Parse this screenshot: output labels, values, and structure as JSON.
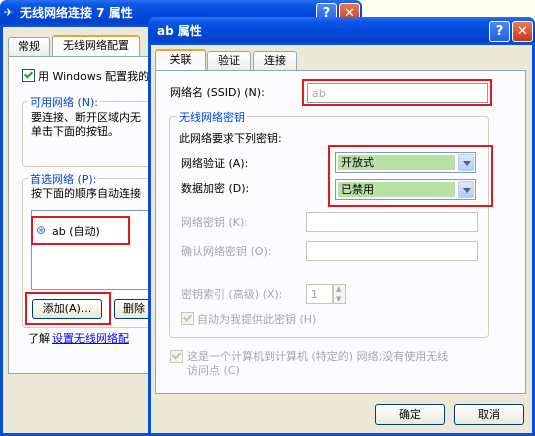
{
  "bg_window": {
    "title": "无线网络连接 7 属性",
    "tabs": [
      "常规",
      "无线网络配置"
    ],
    "use_windows_config": "用 Windows 配置我的",
    "available_networks": {
      "group_label": "可用网络 (N):",
      "desc_line1": "要连接、断开区域内无",
      "desc_line2": "单击下面的按钮。"
    },
    "preferred_networks": {
      "group_label": "首选网络 (P):",
      "desc": "按下面的顺序自动连接",
      "items": [
        "ab (自动)"
      ]
    },
    "add_button": "添加(A)...",
    "remove_button": "删除",
    "learn_prefix": "了解",
    "learn_link": "设置无线网络配"
  },
  "dialog": {
    "title": "ab 属性",
    "tabs": [
      "关联",
      "验证",
      "连接"
    ],
    "ssid": {
      "label": "网络名 (SSID) (N):",
      "value": "ab"
    },
    "security_group": {
      "label": "无线网络密钥",
      "required_text": "此网络要求下列密钥:",
      "auth": {
        "label": "网络验证 (A):",
        "value": "开放式"
      },
      "encryption": {
        "label": "数据加密 (D):",
        "value": "已禁用"
      },
      "network_key_label": "网络密钥 (K):",
      "confirm_key_label": "确认网络密钥 (O):",
      "key_index_label": "密钥索引 (高级) (X):",
      "key_index_value": "1",
      "auto_key_label": "自动为我提供此密钥 (H)"
    },
    "adhoc_line1": "这是一个计算机到计算机 (特定的) 网络;没有使用无线",
    "adhoc_line2": "访问点 (C)",
    "ok_button": "确定",
    "cancel_button": "取消"
  },
  "colors": {
    "titlebar": "#0048d9",
    "highlight_box": "#e0181e",
    "dropdown_fill": "#b9e0a5",
    "dialog_face": "#ece9d8"
  }
}
